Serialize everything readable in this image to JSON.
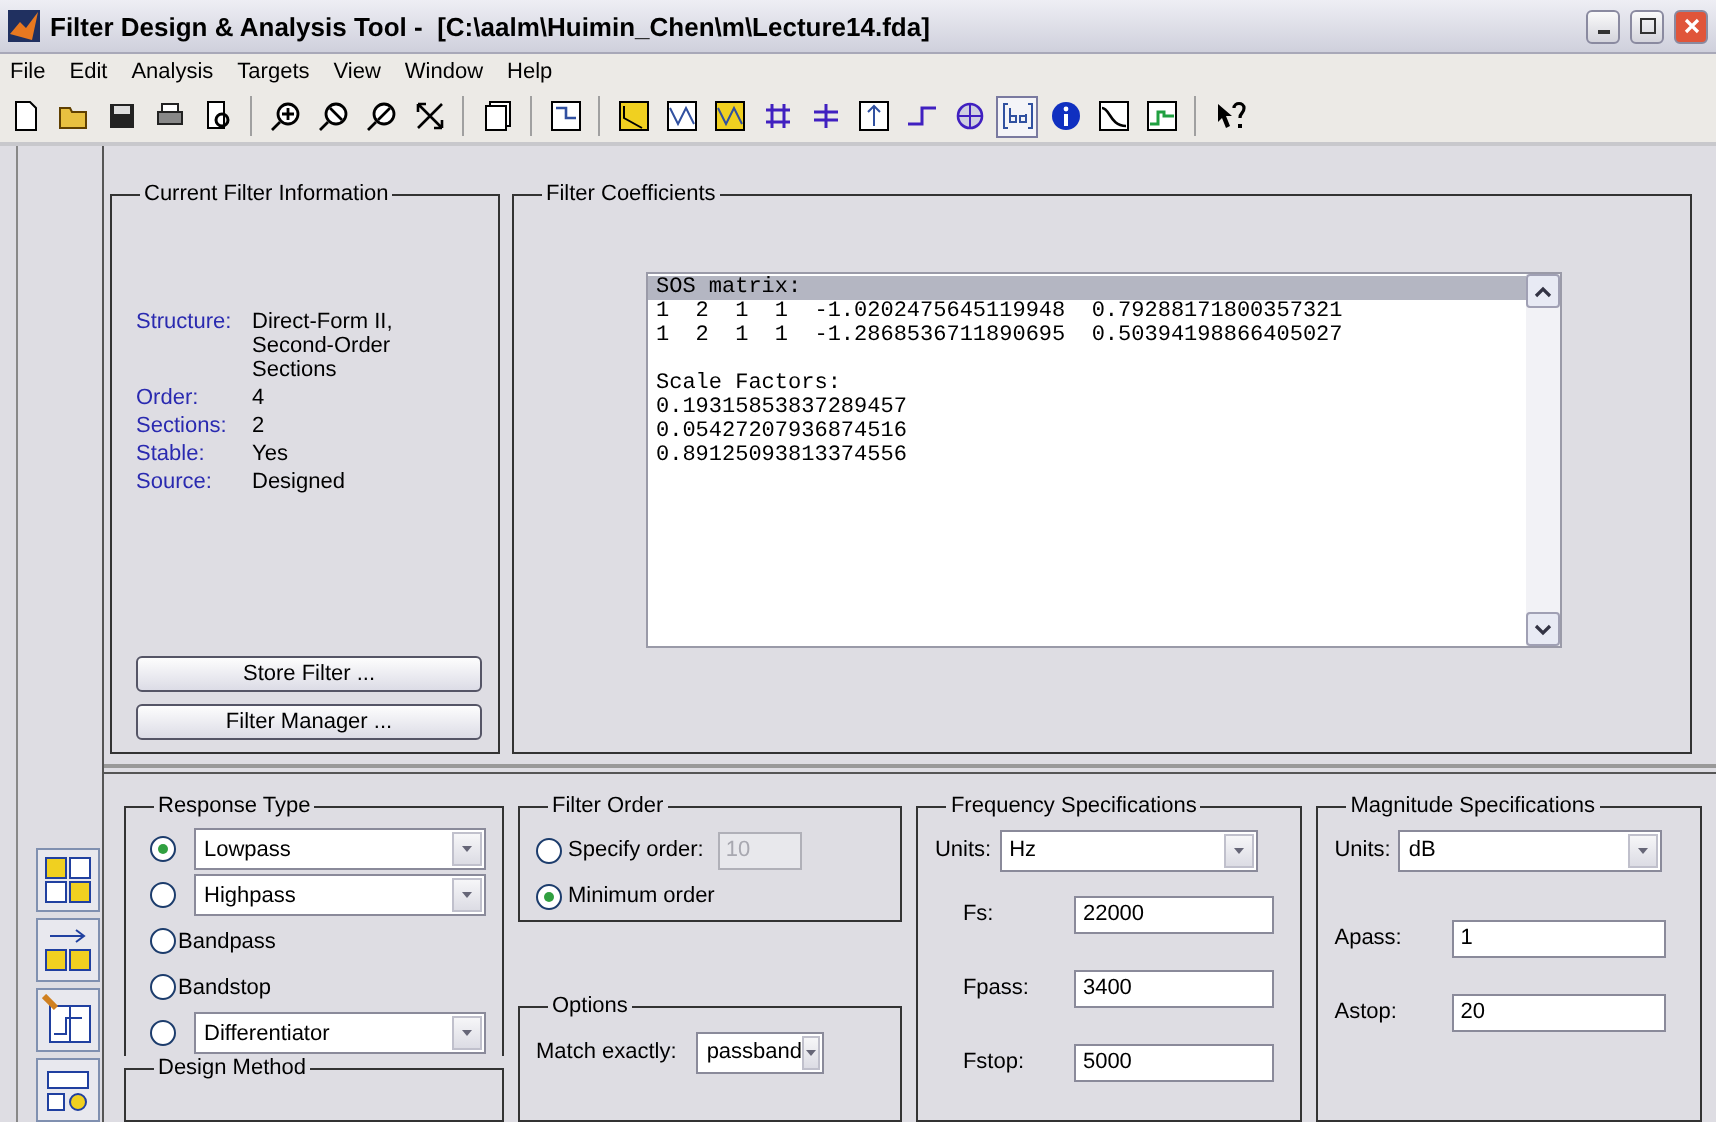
{
  "window": {
    "title": "Filter Design & Analysis Tool -  [C:\\aalm\\Huimin_Chen\\m\\Lecture14.fda]"
  },
  "menu": [
    "File",
    "Edit",
    "Analysis",
    "Targets",
    "View",
    "Window",
    "Help"
  ],
  "toolbar": [
    {
      "pressed": false
    },
    {
      "pressed": false
    },
    {
      "pressed": false
    },
    {
      "pressed": false
    },
    {
      "pressed": false
    },
    {
      "pressed": false
    },
    {
      "pressed": false
    },
    {
      "pressed": false
    },
    {
      "pressed": false
    },
    {
      "pressed": false
    },
    {
      "pressed": false
    },
    {
      "pressed": false
    },
    {
      "pressed": false
    },
    {
      "pressed": false
    },
    {
      "pressed": false
    },
    {
      "pressed": false
    },
    {
      "pressed": false
    },
    {
      "pressed": false
    },
    {
      "pressed": false
    },
    {
      "pressed": true
    },
    {
      "pressed": false
    },
    {
      "pressed": false
    },
    {
      "pressed": false
    },
    {
      "pressed": false
    }
  ],
  "current_filter": {
    "title": "Current Filter Information",
    "fields": [
      {
        "label": "Structure:",
        "value": "Direct-Form II, Second-Order Sections"
      },
      {
        "label": "Order:",
        "value": "4"
      },
      {
        "label": "Sections:",
        "value": "2"
      },
      {
        "label": "Stable:",
        "value": "Yes"
      },
      {
        "label": "Source:",
        "value": "Designed"
      }
    ],
    "buttons": [
      "Store Filter ...",
      "Filter Manager ..."
    ]
  },
  "coefficients": {
    "title": "Filter Coefficients",
    "blocks": [
      {
        "lines": [
          {
            "text": "SOS matrix:",
            "selected": true
          },
          {
            "text": "1  2  1  1  -1.0202475645119948  0.79288171800357321",
            "selected": false
          },
          {
            "text": "1  2  1  1  -1.2868536711890695  0.50394198866405027",
            "selected": false
          }
        ]
      },
      {
        "lines": [
          {
            "text": "Scale Factors:",
            "selected": false
          },
          {
            "text": "0.19315853837289457",
            "selected": false
          },
          {
            "text": "0.05427207936874516",
            "selected": false
          },
          {
            "text": "0.89125093813374556",
            "selected": false
          }
        ]
      }
    ]
  },
  "response_type": {
    "title": "Response Type",
    "options": [
      {
        "kind": "dropdown",
        "label": "Lowpass",
        "selected": true
      },
      {
        "kind": "dropdown",
        "label": "Highpass",
        "selected": false
      },
      {
        "kind": "plain",
        "label": "Bandpass",
        "selected": false
      },
      {
        "kind": "plain",
        "label": "Bandstop",
        "selected": false
      },
      {
        "kind": "dropdown",
        "label": "Differentiator",
        "selected": false
      }
    ],
    "design_method": {
      "title": "Design Method"
    }
  },
  "filter_order": {
    "title": "Filter Order",
    "options": [
      {
        "kind": "specify",
        "label": "Specify order:",
        "value": "10",
        "disabled": true,
        "selected": false
      },
      {
        "kind": "plain",
        "label": "Minimum order",
        "selected": true
      }
    ]
  },
  "options": {
    "title": "Options",
    "match": {
      "label": "Match exactly:",
      "value": "passband"
    }
  },
  "frequency": {
    "title": "Frequency Specifications",
    "units": {
      "label": "Units:",
      "value": "Hz"
    },
    "fields": [
      {
        "label": "Fs:",
        "value": "22000"
      },
      {
        "label": "Fpass:",
        "value": "3400"
      },
      {
        "label": "Fstop:",
        "value": "5000"
      }
    ]
  },
  "magnitude": {
    "title": "Magnitude Specifications",
    "units": {
      "label": "Units:",
      "value": "dB"
    },
    "fields": [
      {
        "label": "Apass:",
        "value": "1"
      },
      {
        "label": "Astop:",
        "value": "20"
      }
    ]
  }
}
